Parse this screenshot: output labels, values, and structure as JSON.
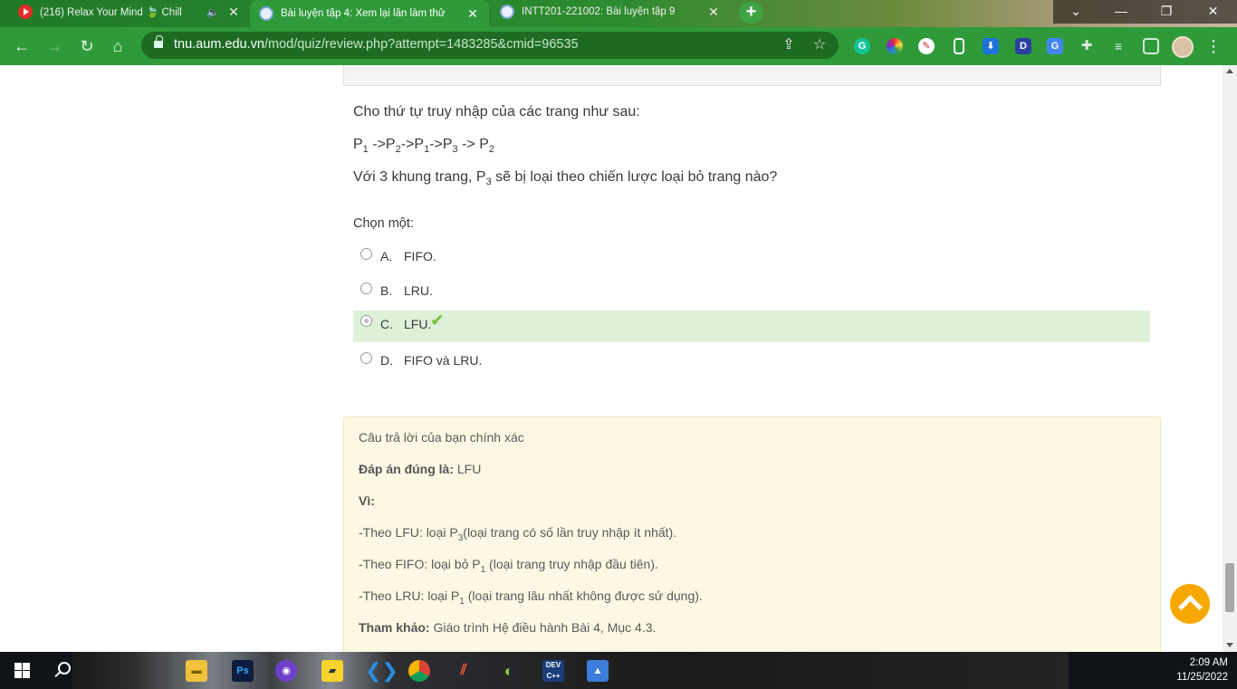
{
  "tabs": [
    {
      "title": "(216) Relax Your Mind 🍃 Chill",
      "icon": "youtube-icon",
      "audio": "🔈"
    },
    {
      "title": "Bài luyện tập 4: Xem lại lần làm thử",
      "icon": "moodle-icon"
    },
    {
      "title": "INTT201-221002: Bài luyện tập 9",
      "icon": "moodle-icon"
    }
  ],
  "address_bar": {
    "domain": "tnu.aum.edu.vn",
    "path": "/mod/quiz/review.php?attempt=1483285&cmid=96535"
  },
  "question": {
    "intro": "Cho thứ tự truy nhập của các trang như sau:",
    "sequence": [
      {
        "t": "P",
        "s": "1"
      },
      {
        "t": " ->P",
        "s": "2"
      },
      {
        "t": "->P",
        "s": "1"
      },
      {
        "t": "->P",
        "s": "3"
      },
      {
        "t": " -> P",
        "s": "2"
      }
    ],
    "prompt_before": "Với 3 khung trang, P",
    "prompt_sub": "3",
    "prompt_after": " sẽ bị loại theo chiến lược loại bỏ trang nào?",
    "choose_label": "Chọn một:",
    "options": [
      {
        "letter": "A.",
        "text": "FIFO.",
        "selected": false,
        "correct": false
      },
      {
        "letter": "B.",
        "text": "LRU.",
        "selected": false,
        "correct": false
      },
      {
        "letter": "C.",
        "text": "LFU.",
        "selected": true,
        "correct": true
      },
      {
        "letter": "D.",
        "text": "FIFO và LRU.",
        "selected": false,
        "correct": false
      }
    ],
    "check_mark": "✔"
  },
  "feedback": {
    "result": "Câu trả lời của bạn chính xác",
    "answer_label": "Đáp án đúng là:",
    "answer_value": " LFU",
    "reason_label": "Vì:",
    "lines": [
      {
        "a": "-Theo LFU: loại P",
        "s": "3",
        "b": "(loại trang có số lần truy nhập ít nhất)."
      },
      {
        "a": "-Theo FIFO: loại bỏ P",
        "s": "1",
        "b": " (loại trang truy nhập đầu tiên)."
      },
      {
        "a": "-Theo LRU: loại P",
        "s": "1",
        "b": " (loại trang lâu nhất không được sử dụng)."
      }
    ],
    "ref_label": "Tham khảo:",
    "ref_value": " Giáo trình Hệ điều hành Bài 4, Mục 4.3."
  },
  "taskbar": {
    "time": "2:09 AM",
    "date": "11/25/2022"
  },
  "colors": {
    "browser_green": "#2f9a3a",
    "correct_bg": "#dff0d8",
    "feedback_bg": "#fcf8e3",
    "back_to_top": "#f7a800"
  }
}
